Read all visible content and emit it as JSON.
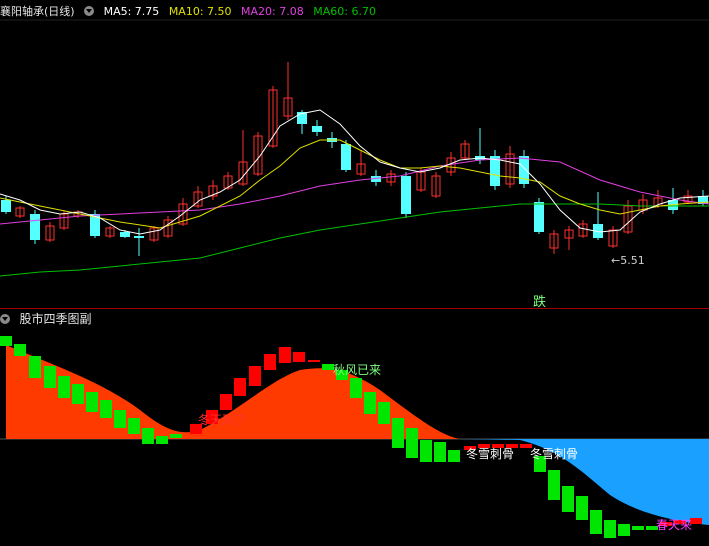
{
  "main": {
    "title": "襄阳轴承(日线)",
    "ma5": "MA5: 7.75",
    "ma10": "MA10: 7.50",
    "ma20": "MA20: 7.08",
    "ma60": "MA60: 6.70",
    "low_marker": "5.51",
    "fall_label": "跌"
  },
  "sub": {
    "title": "股市四季图副",
    "labels": {
      "winter_start": "冬天到了",
      "autumn": "秋风已来",
      "winter_bone1": "冬雪刺骨",
      "winter_bone2": "冬雪刺骨",
      "spring": "春天来"
    }
  },
  "colors": {
    "up": "#ff3030",
    "down": "#54ffff",
    "ma5": "#ffffff",
    "ma10": "#e0e000",
    "ma20": "#e040e0",
    "ma60": "#00c000",
    "area_orange": "#ff3a00",
    "area_blue": "#1aa0ff",
    "bar_green": "#00e600",
    "bar_red": "#ff0000"
  }
}
